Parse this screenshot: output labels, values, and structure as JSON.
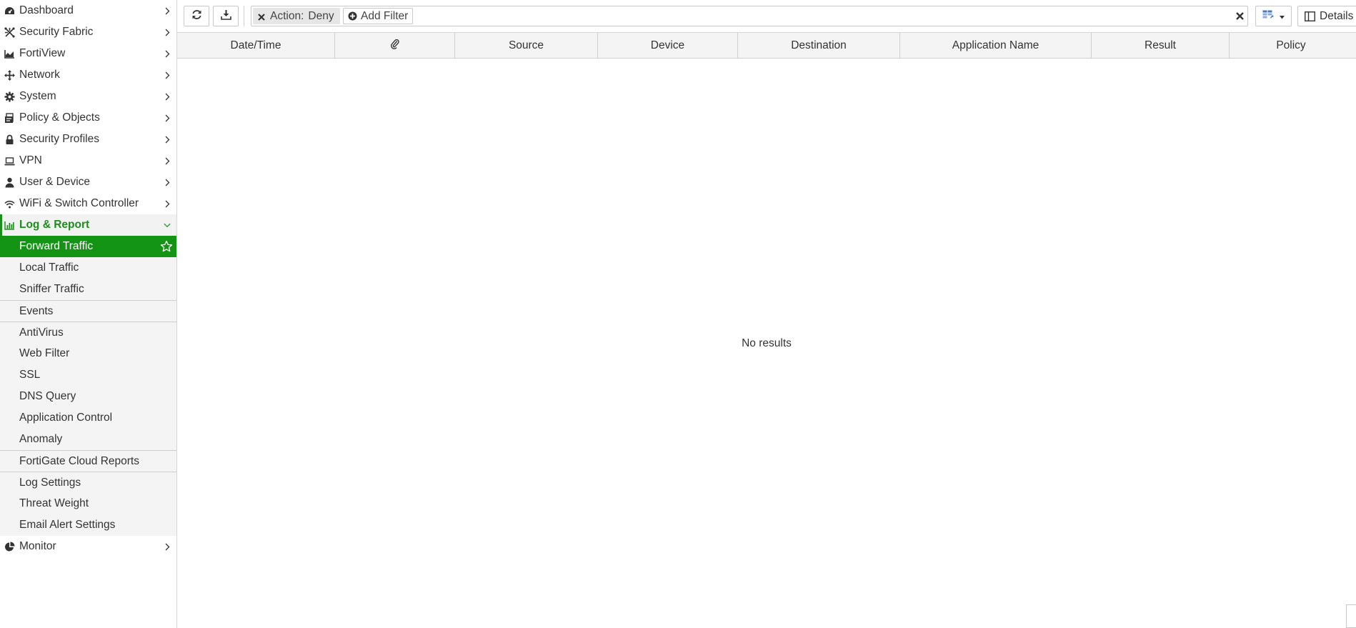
{
  "sidebar": {
    "items": [
      {
        "label": "Dashboard",
        "icon": "dashboard-icon"
      },
      {
        "label": "Security Fabric",
        "icon": "security-fabric-icon"
      },
      {
        "label": "FortiView",
        "icon": "fortiview-icon"
      },
      {
        "label": "Network",
        "icon": "network-icon"
      },
      {
        "label": "System",
        "icon": "gear-icon"
      },
      {
        "label": "Policy & Objects",
        "icon": "policy-icon"
      },
      {
        "label": "Security Profiles",
        "icon": "lock-icon"
      },
      {
        "label": "VPN",
        "icon": "laptop-icon"
      },
      {
        "label": "User & Device",
        "icon": "user-icon"
      },
      {
        "label": "WiFi & Switch Controller",
        "icon": "wifi-icon"
      }
    ],
    "expanded": {
      "label": "Log & Report",
      "icon": "bar-chart-icon"
    },
    "sub_groups": [
      [
        "Forward Traffic",
        "Local Traffic",
        "Sniffer Traffic"
      ],
      [
        "Events"
      ],
      [
        "AntiVirus",
        "Web Filter",
        "SSL",
        "DNS Query",
        "Application Control",
        "Anomaly"
      ],
      [
        "FortiGate Cloud Reports"
      ],
      [
        "Log Settings",
        "Threat Weight",
        "Email Alert Settings"
      ]
    ],
    "active_sub": "Forward Traffic",
    "monitor": {
      "label": "Monitor",
      "icon": "pie-chart-icon"
    }
  },
  "toolbar": {
    "filter": {
      "key": "Action:",
      "value": "Deny"
    },
    "add_filter": "Add Filter",
    "details": "Details"
  },
  "table": {
    "columns": [
      "Date/Time",
      "",
      "Source",
      "Device",
      "Destination",
      "Application Name",
      "Result",
      "Policy"
    ],
    "empty_message": "No results"
  },
  "colors": {
    "accent": "#149414",
    "accent_text": "#1a8f1a"
  }
}
